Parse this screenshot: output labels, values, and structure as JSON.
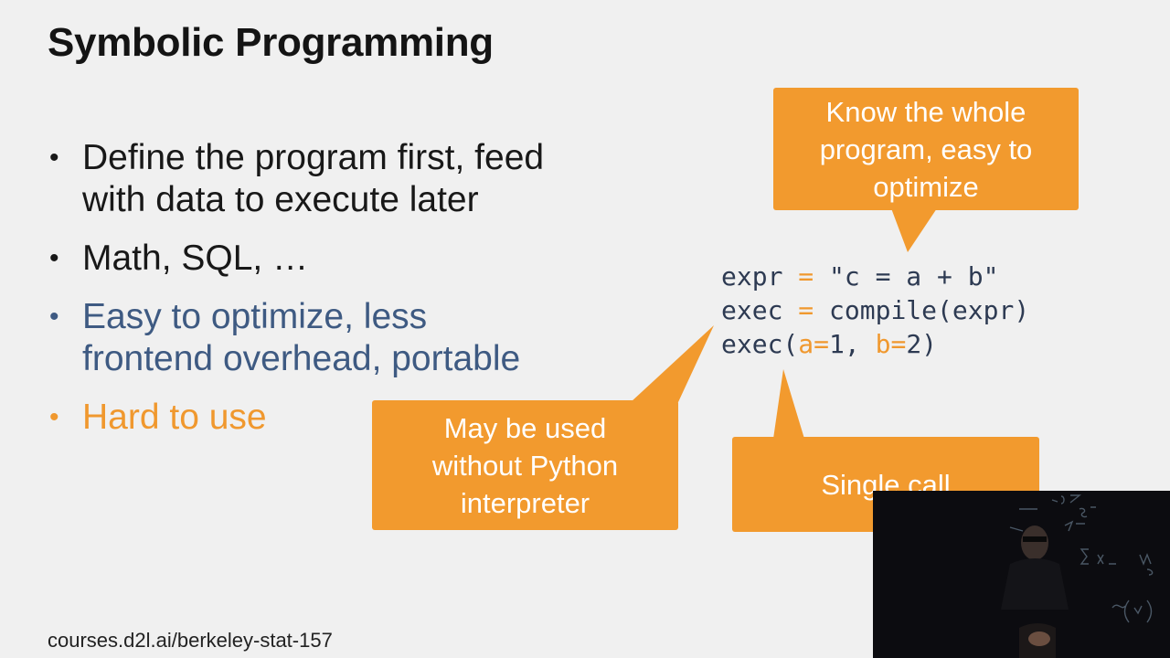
{
  "slide": {
    "title": "Symbolic Programming",
    "bullets": [
      {
        "line1": "Define the program first, feed",
        "line2": "with data to execute later"
      },
      {
        "line1": "Math, SQL, …"
      },
      {
        "line1": "Easy to optimize, less",
        "line2": "frontend overhead, portable"
      },
      {
        "line1": "Hard to use"
      }
    ],
    "code": {
      "line1": {
        "name": "expr",
        "op": "=",
        "rest": "\"c = a + b\""
      },
      "line2": {
        "name": "exec",
        "op": "=",
        "fn": "compile",
        "arg": "(expr)"
      },
      "line3": {
        "fn": "exec(",
        "a": "a",
        "eq1": "=",
        "v1": "1, ",
        "b": "b",
        "eq2": "=",
        "v2": "2)"
      }
    },
    "callouts": {
      "top": [
        "Know the whole",
        "program, easy to",
        "optimize"
      ],
      "left": [
        "May be used",
        "without Python",
        "interpreter"
      ],
      "bottom": [
        "Single call"
      ]
    },
    "footer": "courses.d2l.ai/berkeley-stat-157"
  },
  "colors": {
    "callout": "#f29a2e",
    "bullet_blue": "#3e5a82",
    "bullet_orange": "#f0982e"
  }
}
